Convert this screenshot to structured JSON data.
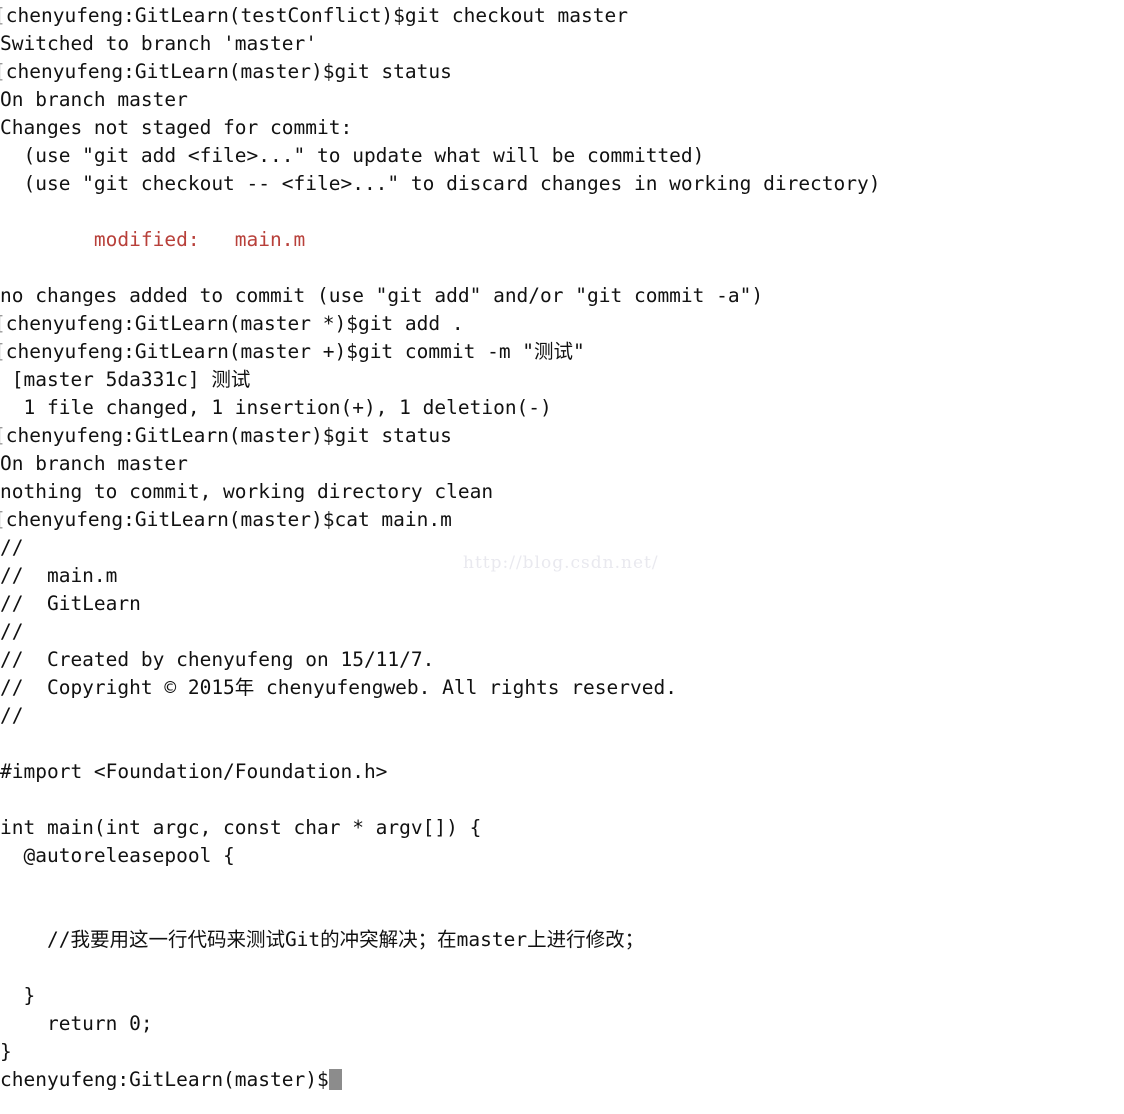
{
  "terminal": {
    "background_color": "#ffffff",
    "foreground_color": "#111111",
    "highlight_color": "#b8403a",
    "cursor_color": "#8c8c8c",
    "watermark": "http://blog.csdn.net/",
    "prompt_bracket": "[",
    "lines": [
      {
        "id": "l01",
        "kind": "prompt",
        "bracket": "[",
        "text": "chenyufeng:GitLearn(testConflict)$git checkout master"
      },
      {
        "id": "l02",
        "kind": "output",
        "text": "Switched to branch 'master'"
      },
      {
        "id": "l03",
        "kind": "prompt",
        "bracket": "[",
        "text": "chenyufeng:GitLearn(master)$git status"
      },
      {
        "id": "l04",
        "kind": "output",
        "text": "On branch master"
      },
      {
        "id": "l05",
        "kind": "output",
        "text": "Changes not staged for commit:"
      },
      {
        "id": "l06",
        "kind": "output",
        "text": "  (use \"git add <file>...\" to update what will be committed)"
      },
      {
        "id": "l07",
        "kind": "output",
        "text": "  (use \"git checkout -- <file>...\" to discard changes in working directory)"
      },
      {
        "id": "l08",
        "kind": "blank",
        "text": ""
      },
      {
        "id": "l09",
        "kind": "output",
        "color": "red",
        "text": "        modified:   main.m"
      },
      {
        "id": "l10",
        "kind": "blank",
        "text": ""
      },
      {
        "id": "l11",
        "kind": "output",
        "text": "no changes added to commit (use \"git add\" and/or \"git commit -a\")"
      },
      {
        "id": "l12",
        "kind": "prompt",
        "bracket": "[",
        "text": "chenyufeng:GitLearn(master *)$git add ."
      },
      {
        "id": "l13",
        "kind": "prompt",
        "bracket": "[",
        "text": "chenyufeng:GitLearn(master +)$git commit -m \"测试\""
      },
      {
        "id": "l14",
        "kind": "output",
        "text": " [master 5da331c] 测试"
      },
      {
        "id": "l15",
        "kind": "output",
        "text": "  1 file changed, 1 insertion(+), 1 deletion(-)"
      },
      {
        "id": "l16",
        "kind": "prompt",
        "bracket": "[",
        "text": "chenyufeng:GitLearn(master)$git status"
      },
      {
        "id": "l17",
        "kind": "output",
        "text": "On branch master"
      },
      {
        "id": "l18",
        "kind": "output",
        "text": "nothing to commit, working directory clean"
      },
      {
        "id": "l19",
        "kind": "prompt",
        "bracket": "[",
        "text": "chenyufeng:GitLearn(master)$cat main.m"
      },
      {
        "id": "l20",
        "kind": "output",
        "text": "//"
      },
      {
        "id": "l21",
        "kind": "output",
        "text": "//  main.m"
      },
      {
        "id": "l22",
        "kind": "output",
        "text": "//  GitLearn"
      },
      {
        "id": "l23",
        "kind": "output",
        "text": "//"
      },
      {
        "id": "l24",
        "kind": "output",
        "text": "//  Created by chenyufeng on 15/11/7."
      },
      {
        "id": "l25",
        "kind": "output",
        "text": "//  Copyright © 2015年 chenyufengweb. All rights reserved."
      },
      {
        "id": "l26",
        "kind": "output",
        "text": "//"
      },
      {
        "id": "l27",
        "kind": "blank",
        "text": ""
      },
      {
        "id": "l28",
        "kind": "output",
        "text": "#import <Foundation/Foundation.h>"
      },
      {
        "id": "l29",
        "kind": "blank",
        "text": ""
      },
      {
        "id": "l30",
        "kind": "output",
        "text": "int main(int argc, const char * argv[]) {"
      },
      {
        "id": "l31",
        "kind": "output",
        "text": "  @autoreleasepool {"
      },
      {
        "id": "l32",
        "kind": "blank",
        "text": ""
      },
      {
        "id": "l33",
        "kind": "blank",
        "text": ""
      },
      {
        "id": "l34",
        "kind": "output",
        "text": "    //我要用这一行代码来测试Git的冲突解决；在master上进行修改；"
      },
      {
        "id": "l35",
        "kind": "blank",
        "text": ""
      },
      {
        "id": "l36",
        "kind": "output",
        "text": "  }"
      },
      {
        "id": "l37",
        "kind": "output",
        "text": "    return 0;"
      },
      {
        "id": "l38",
        "kind": "output",
        "text": "}"
      },
      {
        "id": "l39",
        "kind": "prompt-active",
        "bracket": "",
        "text": "chenyufeng:GitLearn(master)$"
      }
    ]
  }
}
